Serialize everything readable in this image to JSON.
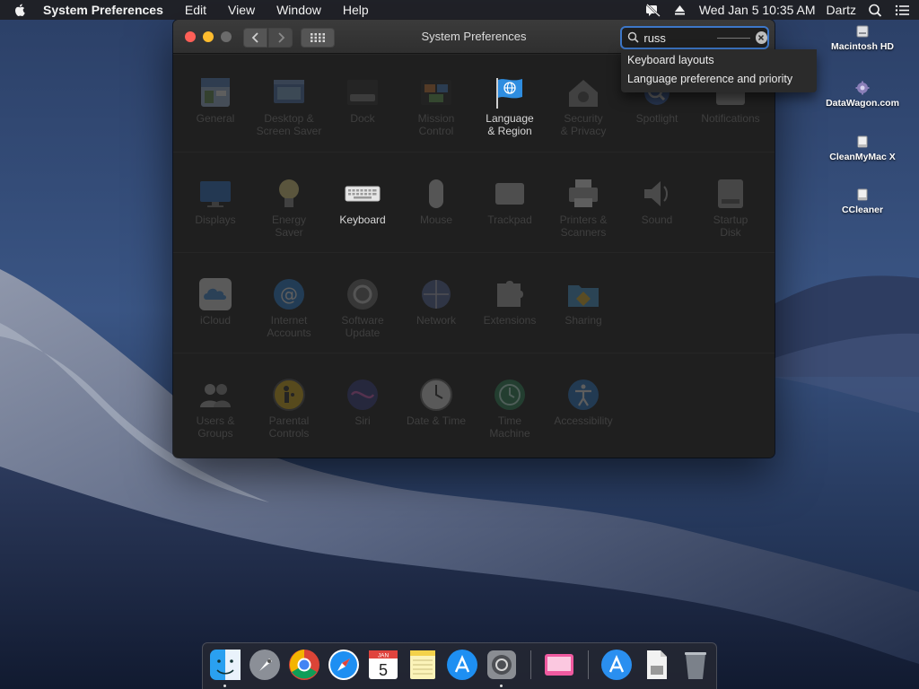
{
  "menubar": {
    "app_name": "System Preferences",
    "menus": [
      "Edit",
      "View",
      "Window",
      "Help"
    ],
    "clock": "Wed Jan 5  10:35 AM",
    "user": "Dartz"
  },
  "desktop_icons": [
    {
      "label": "Macintosh HD",
      "icon": "hard-drive-icon"
    },
    {
      "label": "DataWagon.com",
      "icon": "gear-disk-icon"
    },
    {
      "label": "CleanMyMac X",
      "icon": "disk-image-icon"
    },
    {
      "label": "CCleaner",
      "icon": "disk-image-icon"
    }
  ],
  "window": {
    "title": "System Preferences",
    "search": {
      "value": "russ",
      "placeholder": "Search"
    },
    "results": [
      "Keyboard layouts",
      "Language preference and priority"
    ]
  },
  "prefs": {
    "general": "General",
    "desktop": "Desktop &\nScreen Saver",
    "dock": "Dock",
    "mission": "Mission\nControl",
    "language": "Language\n& Region",
    "security": "Security\n& Privacy",
    "spotlight": "Spotlight",
    "notifications": "Notifications",
    "displays": "Displays",
    "energy": "Energy\nSaver",
    "keyboard": "Keyboard",
    "mouse": "Mouse",
    "trackpad": "Trackpad",
    "printers": "Printers &\nScanners",
    "sound": "Sound",
    "startup": "Startup\nDisk",
    "icloud": "iCloud",
    "internet": "Internet\nAccounts",
    "software": "Software\nUpdate",
    "network": "Network",
    "extensions": "Extensions",
    "sharing": "Sharing",
    "users": "Users &\nGroups",
    "parental": "Parental\nControls",
    "siri": "Siri",
    "datetime": "Date & Time",
    "timemachine": "Time\nMachine",
    "accessibility": "Accessibility"
  },
  "dock": {
    "calendar_month": "JAN",
    "calendar_day": "5"
  },
  "colors": {
    "accent": "#3d77c8",
    "close": "#fe5f57",
    "minimize": "#febc2e"
  }
}
